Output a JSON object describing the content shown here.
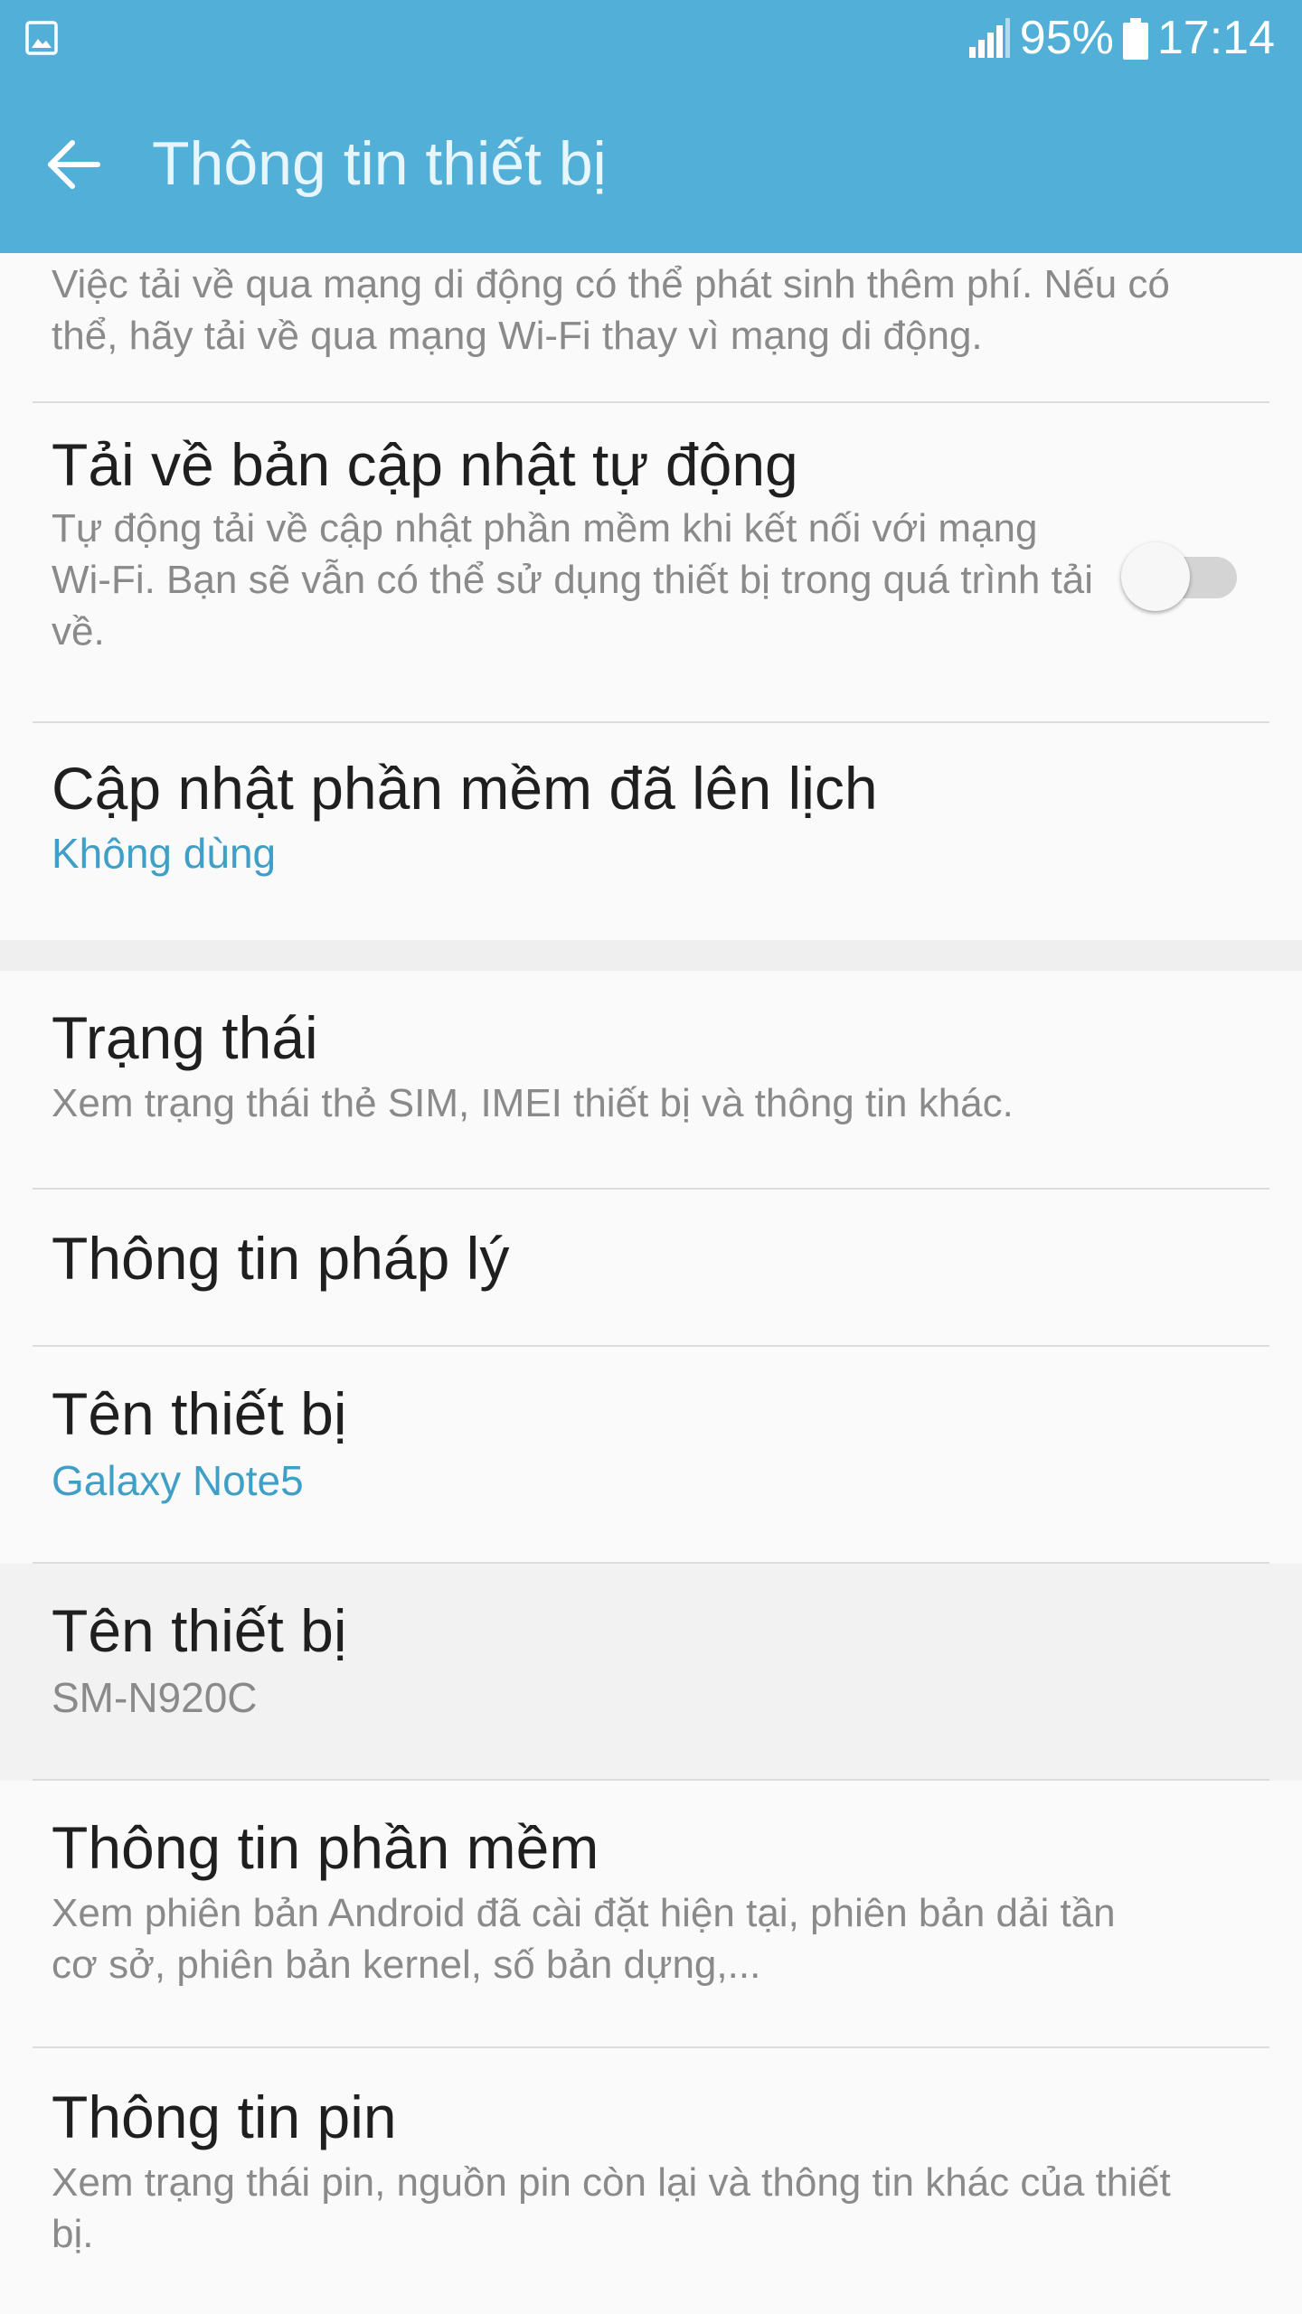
{
  "status_bar": {
    "left_icon": "image-icon",
    "signal_icon": "signal-icon",
    "battery_percent": "95%",
    "battery_icon": "battery-icon",
    "time": "17:14"
  },
  "app_bar": {
    "back_icon": "back-arrow-icon",
    "title": "Thông tin thiết bị"
  },
  "items": [
    {
      "desc": "Việc tải về qua mạng di động có thể phát sinh thêm phí. Nếu có thể, hãy tải về qua mạng Wi-Fi thay vì mạng di động."
    },
    {
      "title": "Tải về bản cập nhật tự động",
      "desc": "Tự động tải về cập nhật phần mềm khi kết nối với mạng Wi-Fi. Bạn sẽ vẫn có thể sử dụng thiết bị trong quá trình tải về.",
      "toggle_on": false
    },
    {
      "title": "Cập nhật phần mềm đã lên lịch",
      "value": "Không dùng"
    },
    {
      "title": "Trạng thái",
      "desc": "Xem trạng thái thẻ SIM, IMEI thiết bị và thông tin khác."
    },
    {
      "title": "Thông tin pháp lý"
    },
    {
      "title": "Tên thiết bị",
      "value": "Galaxy Note5"
    },
    {
      "title": "Tên thiết bị",
      "value": "SM-N920C"
    },
    {
      "title": "Thông tin phần mềm",
      "desc": "Xem phiên bản Android đã cài đặt hiện tại, phiên bản dải tần cơ sở, phiên bản kernel, số bản dựng,..."
    },
    {
      "title": "Thông tin pin",
      "desc": "Xem trạng thái pin, nguồn pin còn lại và thông tin khác của thiết bị."
    }
  ],
  "colors": {
    "header_bg": "#52b0d8",
    "accent_value": "#3f9fc7",
    "page_bg": "#fafafa"
  }
}
